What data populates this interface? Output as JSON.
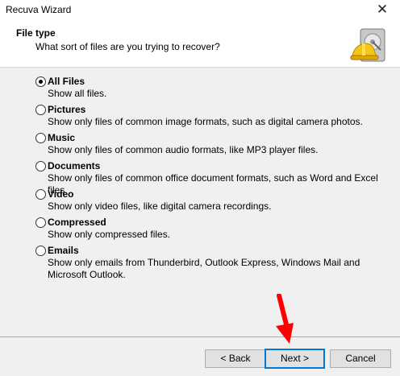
{
  "window": {
    "title": "Recuva Wizard",
    "close_glyph": "✕"
  },
  "header": {
    "title": "File type",
    "subtitle": "What sort of files are you trying to recover?",
    "logo_icon": "hard-drive-hardhat-icon"
  },
  "options": [
    {
      "label": "All Files",
      "description": "Show all files.",
      "selected": true
    },
    {
      "label": "Pictures",
      "description": "Show only files of common image formats, such as digital camera photos.",
      "selected": false
    },
    {
      "label": "Music",
      "description": "Show only files of common audio formats, like MP3 player files.",
      "selected": false
    },
    {
      "label": "Documents",
      "description": "Show only files of common office document formats, such as Word and Excel files.",
      "selected": false
    },
    {
      "label": "Video",
      "description": "Show only video files, like digital camera recordings.",
      "selected": false
    },
    {
      "label": "Compressed",
      "description": "Show only compressed files.",
      "selected": false
    },
    {
      "label": "Emails",
      "description": "Show only emails from Thunderbird, Outlook Express, Windows Mail and Microsoft Outlook.",
      "selected": false
    }
  ],
  "buttons": {
    "back": "< Back",
    "next": "Next >",
    "cancel": "Cancel"
  },
  "colors": {
    "accent": "#0078d7",
    "arrow": "#ff0000"
  }
}
